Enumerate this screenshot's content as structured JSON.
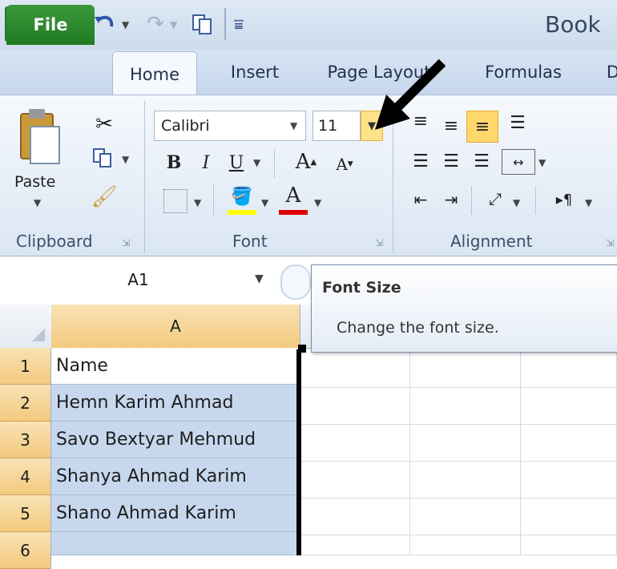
{
  "window": {
    "title": "Book"
  },
  "quick_access": {
    "save_icon": "save-icon",
    "undo_icon": "undo-icon",
    "redo_icon": "redo-icon"
  },
  "tabs": [
    "File",
    "Home",
    "Insert",
    "Page Layout",
    "Formulas",
    "D"
  ],
  "ribbon": {
    "clipboard": {
      "paste_label": "Paste",
      "group_label": "Clipboard"
    },
    "font": {
      "name": "Calibri",
      "size": "11",
      "group_label": "Font"
    },
    "alignment": {
      "group_label": "Alignment"
    },
    "colors": {
      "highlight": "#ffff00",
      "font_color": "#e00000",
      "accent": "#ffe18a"
    }
  },
  "formula_bar": {
    "name_box": "A1"
  },
  "tooltip": {
    "title": "Font Size",
    "description": "Change the font size."
  },
  "grid": {
    "column_A": "A",
    "rows": [
      {
        "num": "1",
        "value": "Name"
      },
      {
        "num": "2",
        "value": "Hemn Karim Ahmad"
      },
      {
        "num": "3",
        "value": "Savo Bextyar Mehmud"
      },
      {
        "num": "4",
        "value": "Shanya Ahmad Karim"
      },
      {
        "num": "5",
        "value": "Shano Ahmad Karim"
      },
      {
        "num": "6",
        "value": ""
      }
    ]
  }
}
